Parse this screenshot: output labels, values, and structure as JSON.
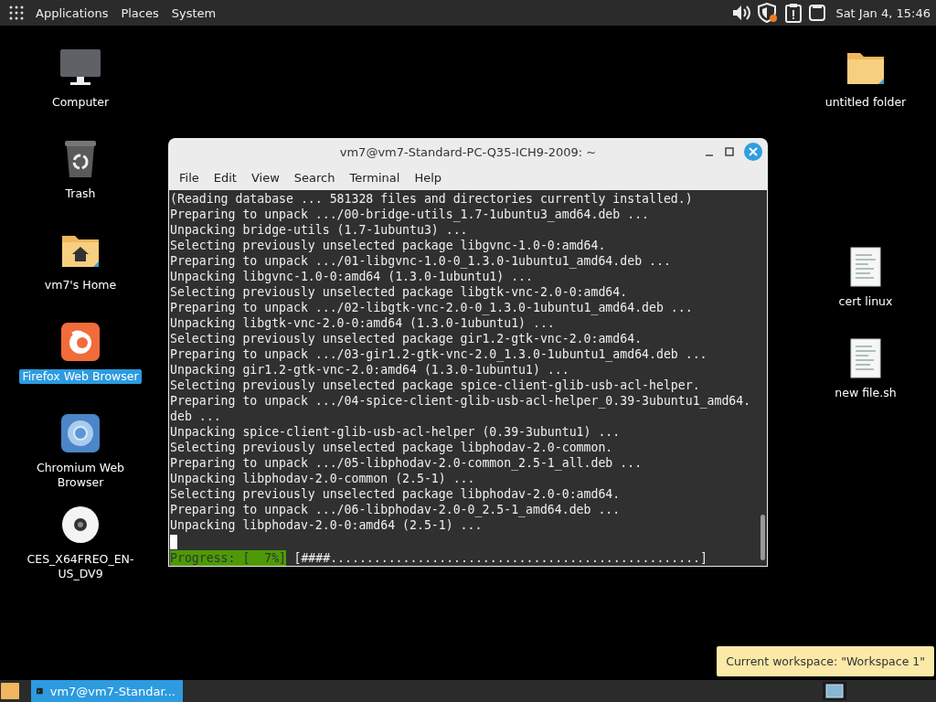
{
  "top_panel": {
    "menus": [
      "Applications",
      "Places",
      "System"
    ],
    "clock": "Sat Jan 4, 15:46"
  },
  "desktop_icons": [
    {
      "label": "Computer",
      "kind": "computer",
      "selected": false
    },
    {
      "label": "Trash",
      "kind": "trash",
      "selected": false
    },
    {
      "label": "vm7's Home",
      "kind": "home",
      "selected": false
    },
    {
      "label": "Firefox Web Browser",
      "kind": "firefox",
      "selected": true
    },
    {
      "label": "Chromium Web Browser",
      "kind": "chromium",
      "selected": false
    },
    {
      "label": "CES_X64FREO_EN-US_DV9",
      "kind": "disc",
      "selected": false
    },
    {
      "label": "untitled folder",
      "kind": "folder",
      "selected": false
    },
    {
      "label": "cert linux",
      "kind": "document",
      "selected": false
    },
    {
      "label": "new file.sh",
      "kind": "document",
      "selected": false
    }
  ],
  "terminal": {
    "title": "vm7@vm7-Standard-PC-Q35-ICH9-2009: ~",
    "menu": [
      "File",
      "Edit",
      "View",
      "Search",
      "Terminal",
      "Help"
    ],
    "lines": [
      "(Reading database ... 581328 files and directories currently installed.)",
      "Preparing to unpack .../00-bridge-utils_1.7-1ubuntu3_amd64.deb ...",
      "Unpacking bridge-utils (1.7-1ubuntu3) ...",
      "Selecting previously unselected package libgvnc-1.0-0:amd64.",
      "Preparing to unpack .../01-libgvnc-1.0-0_1.3.0-1ubuntu1_amd64.deb ...",
      "Unpacking libgvnc-1.0-0:amd64 (1.3.0-1ubuntu1) ...",
      "Selecting previously unselected package libgtk-vnc-2.0-0:amd64.",
      "Preparing to unpack .../02-libgtk-vnc-2.0-0_1.3.0-1ubuntu1_amd64.deb ...",
      "Unpacking libgtk-vnc-2.0-0:amd64 (1.3.0-1ubuntu1) ...",
      "Selecting previously unselected package gir1.2-gtk-vnc-2.0:amd64.",
      "Preparing to unpack .../03-gir1.2-gtk-vnc-2.0_1.3.0-1ubuntu1_amd64.deb ...",
      "Unpacking gir1.2-gtk-vnc-2.0:amd64 (1.3.0-1ubuntu1) ...",
      "Selecting previously unselected package spice-client-glib-usb-acl-helper.",
      "Preparing to unpack .../04-spice-client-glib-usb-acl-helper_0.39-3ubuntu1_amd64.",
      "deb ...",
      "Unpacking spice-client-glib-usb-acl-helper (0.39-3ubuntu1) ...",
      "Selecting previously unselected package libphodav-2.0-common.",
      "Preparing to unpack .../05-libphodav-2.0-common_2.5-1_all.deb ...",
      "Unpacking libphodav-2.0-common (2.5-1) ...",
      "Selecting previously unselected package libphodav-2.0-0:amd64.",
      "Preparing to unpack .../06-libphodav-2.0-0_2.5-1_amd64.deb ...",
      "Unpacking libphodav-2.0-0:amd64 (2.5-1) ..."
    ],
    "progress": {
      "label": "Progress: [  7%]",
      "bar": "[####...................................................]"
    }
  },
  "tooltip": "Current workspace: \"Workspace 1\"",
  "taskbar": {
    "tasks": [
      {
        "label": "vm7@vm7-Standar...",
        "selected": true
      }
    ]
  }
}
